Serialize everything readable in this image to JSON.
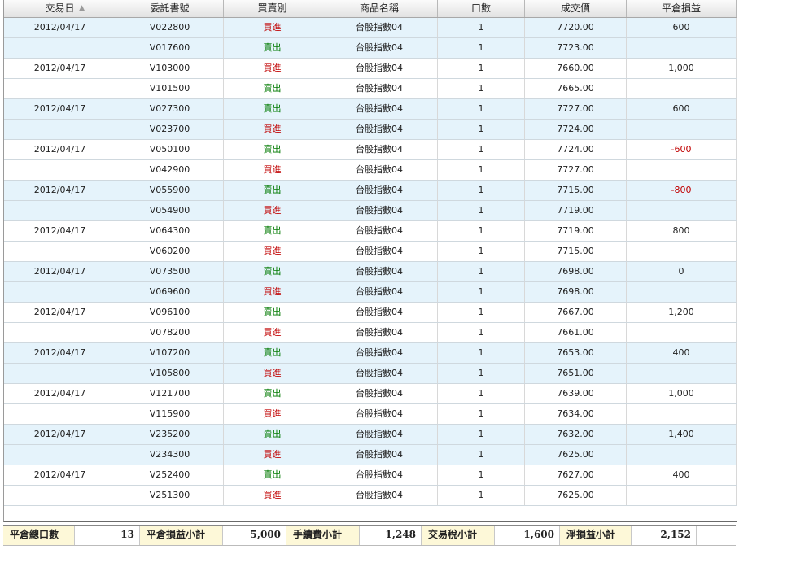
{
  "columns": [
    {
      "label": "交易日"
    },
    {
      "label": "委託書號"
    },
    {
      "label": "買賣別"
    },
    {
      "label": "商品名稱"
    },
    {
      "label": "口數"
    },
    {
      "label": "成交價"
    },
    {
      "label": "平倉損益"
    }
  ],
  "sort_indicator": "▲",
  "rows": [
    {
      "date": "2012/04/17",
      "order": "V022800",
      "side": "買進",
      "product": "台股指數04",
      "qty": "1",
      "price": "7720.00",
      "pnl": "600"
    },
    {
      "date": "",
      "order": "V017600",
      "side": "賣出",
      "product": "台股指數04",
      "qty": "1",
      "price": "7723.00",
      "pnl": ""
    },
    {
      "date": "2012/04/17",
      "order": "V103000",
      "side": "買進",
      "product": "台股指數04",
      "qty": "1",
      "price": "7660.00",
      "pnl": "1,000"
    },
    {
      "date": "",
      "order": "V101500",
      "side": "賣出",
      "product": "台股指數04",
      "qty": "1",
      "price": "7665.00",
      "pnl": ""
    },
    {
      "date": "2012/04/17",
      "order": "V027300",
      "side": "賣出",
      "product": "台股指數04",
      "qty": "1",
      "price": "7727.00",
      "pnl": "600"
    },
    {
      "date": "",
      "order": "V023700",
      "side": "買進",
      "product": "台股指數04",
      "qty": "1",
      "price": "7724.00",
      "pnl": ""
    },
    {
      "date": "2012/04/17",
      "order": "V050100",
      "side": "賣出",
      "product": "台股指數04",
      "qty": "1",
      "price": "7724.00",
      "pnl": "-600"
    },
    {
      "date": "",
      "order": "V042900",
      "side": "買進",
      "product": "台股指數04",
      "qty": "1",
      "price": "7727.00",
      "pnl": ""
    },
    {
      "date": "2012/04/17",
      "order": "V055900",
      "side": "賣出",
      "product": "台股指數04",
      "qty": "1",
      "price": "7715.00",
      "pnl": "-800"
    },
    {
      "date": "",
      "order": "V054900",
      "side": "買進",
      "product": "台股指數04",
      "qty": "1",
      "price": "7719.00",
      "pnl": ""
    },
    {
      "date": "2012/04/17",
      "order": "V064300",
      "side": "賣出",
      "product": "台股指數04",
      "qty": "1",
      "price": "7719.00",
      "pnl": "800"
    },
    {
      "date": "",
      "order": "V060200",
      "side": "買進",
      "product": "台股指數04",
      "qty": "1",
      "price": "7715.00",
      "pnl": ""
    },
    {
      "date": "2012/04/17",
      "order": "V073500",
      "side": "賣出",
      "product": "台股指數04",
      "qty": "1",
      "price": "7698.00",
      "pnl": "0"
    },
    {
      "date": "",
      "order": "V069600",
      "side": "買進",
      "product": "台股指數04",
      "qty": "1",
      "price": "7698.00",
      "pnl": ""
    },
    {
      "date": "2012/04/17",
      "order": "V096100",
      "side": "賣出",
      "product": "台股指數04",
      "qty": "1",
      "price": "7667.00",
      "pnl": "1,200"
    },
    {
      "date": "",
      "order": "V078200",
      "side": "買進",
      "product": "台股指數04",
      "qty": "1",
      "price": "7661.00",
      "pnl": ""
    },
    {
      "date": "2012/04/17",
      "order": "V107200",
      "side": "賣出",
      "product": "台股指數04",
      "qty": "1",
      "price": "7653.00",
      "pnl": "400"
    },
    {
      "date": "",
      "order": "V105800",
      "side": "買進",
      "product": "台股指數04",
      "qty": "1",
      "price": "7651.00",
      "pnl": ""
    },
    {
      "date": "2012/04/17",
      "order": "V121700",
      "side": "賣出",
      "product": "台股指數04",
      "qty": "1",
      "price": "7639.00",
      "pnl": "1,000"
    },
    {
      "date": "",
      "order": "V115900",
      "side": "買進",
      "product": "台股指數04",
      "qty": "1",
      "price": "7634.00",
      "pnl": ""
    },
    {
      "date": "2012/04/17",
      "order": "V235200",
      "side": "賣出",
      "product": "台股指數04",
      "qty": "1",
      "price": "7632.00",
      "pnl": "1,400"
    },
    {
      "date": "",
      "order": "V234300",
      "side": "買進",
      "product": "台股指數04",
      "qty": "1",
      "price": "7625.00",
      "pnl": ""
    },
    {
      "date": "2012/04/17",
      "order": "V252400",
      "side": "賣出",
      "product": "台股指數04",
      "qty": "1",
      "price": "7627.00",
      "pnl": "400"
    },
    {
      "date": "",
      "order": "V251300",
      "side": "買進",
      "product": "台股指數04",
      "qty": "1",
      "price": "7625.00",
      "pnl": ""
    }
  ],
  "summary": [
    {
      "label": "平倉總口數",
      "value": "13"
    },
    {
      "label": "平倉損益小計",
      "value": "5,000"
    },
    {
      "label": "手續費小計",
      "value": "1,248"
    },
    {
      "label": "交易稅小計",
      "value": "1,600"
    },
    {
      "label": "淨損益小計",
      "value": "2,152"
    }
  ],
  "colors": {
    "buy": "#c00000",
    "sell": "#007a00",
    "negative": "#c00000",
    "alt_row": "#e5f3fb",
    "summary_label_bg": "#fdf8d8"
  }
}
